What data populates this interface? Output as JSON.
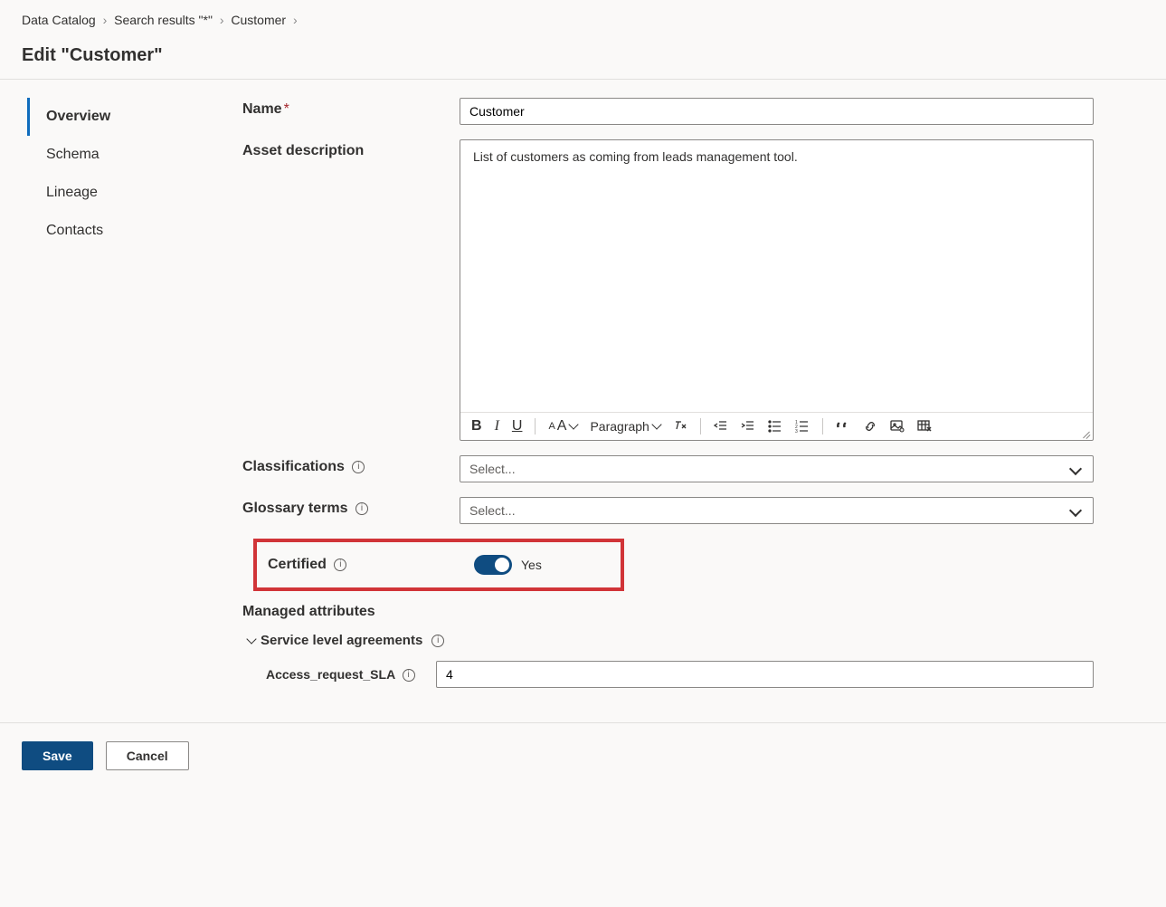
{
  "breadcrumb": {
    "items": [
      "Data Catalog",
      "Search results \"*\"",
      "Customer"
    ]
  },
  "page_title": "Edit \"Customer\"",
  "sidebar": {
    "items": [
      {
        "label": "Overview",
        "active": true
      },
      {
        "label": "Schema",
        "active": false
      },
      {
        "label": "Lineage",
        "active": false
      },
      {
        "label": "Contacts",
        "active": false
      }
    ]
  },
  "form": {
    "name": {
      "label": "Name",
      "value": "Customer",
      "required": true
    },
    "description": {
      "label": "Asset description",
      "value": "List of customers as coming from leads management tool.",
      "paragraph_label": "Paragraph"
    },
    "classifications": {
      "label": "Classifications",
      "placeholder": "Select..."
    },
    "glossary": {
      "label": "Glossary terms",
      "placeholder": "Select..."
    },
    "certified": {
      "label": "Certified",
      "value_label": "Yes",
      "value": true
    },
    "managed_attributes": {
      "label": "Managed attributes",
      "group": {
        "label": "Service level agreements",
        "attrs": [
          {
            "label": "Access_request_SLA",
            "value": "4"
          }
        ]
      }
    }
  },
  "footer": {
    "save": "Save",
    "cancel": "Cancel"
  }
}
